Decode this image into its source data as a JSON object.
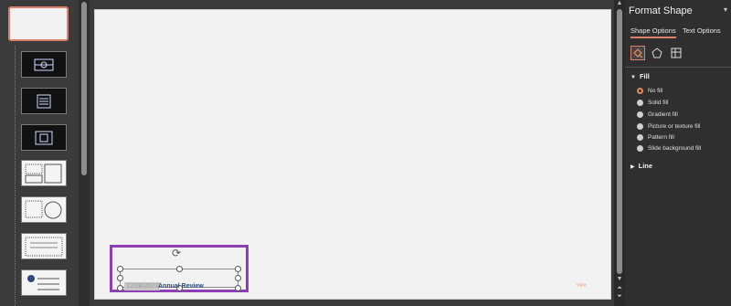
{
  "format_pane": {
    "title": "Format Shape",
    "tabs": [
      "Shape Options",
      "Text Options"
    ],
    "icon_tabs": [
      "fill-line-icon",
      "effects-pentagon-icon",
      "size-properties-icon"
    ],
    "fill": {
      "label": "Fill",
      "options": [
        {
          "label": "No fill",
          "checked": true
        },
        {
          "label": "Solid fill",
          "checked": false
        },
        {
          "label": "Gradient fill",
          "checked": false
        },
        {
          "label": "Picture or texture fill",
          "checked": false
        },
        {
          "label": "Pattern fill",
          "checked": false
        },
        {
          "label": "Slide background fill",
          "checked": false
        }
      ]
    },
    "line": {
      "label": "Line"
    }
  },
  "slide": {
    "footer_date": "12/28/2023",
    "footer_text": "Annual Review",
    "page_number": "<#>"
  },
  "colors": {
    "accent": "#d9816b",
    "selection": "#8e3fb5",
    "pane_bg": "#2f2f2f",
    "canvas_bg": "#3a3a3a",
    "slide_bg": "#f3f2f2"
  }
}
